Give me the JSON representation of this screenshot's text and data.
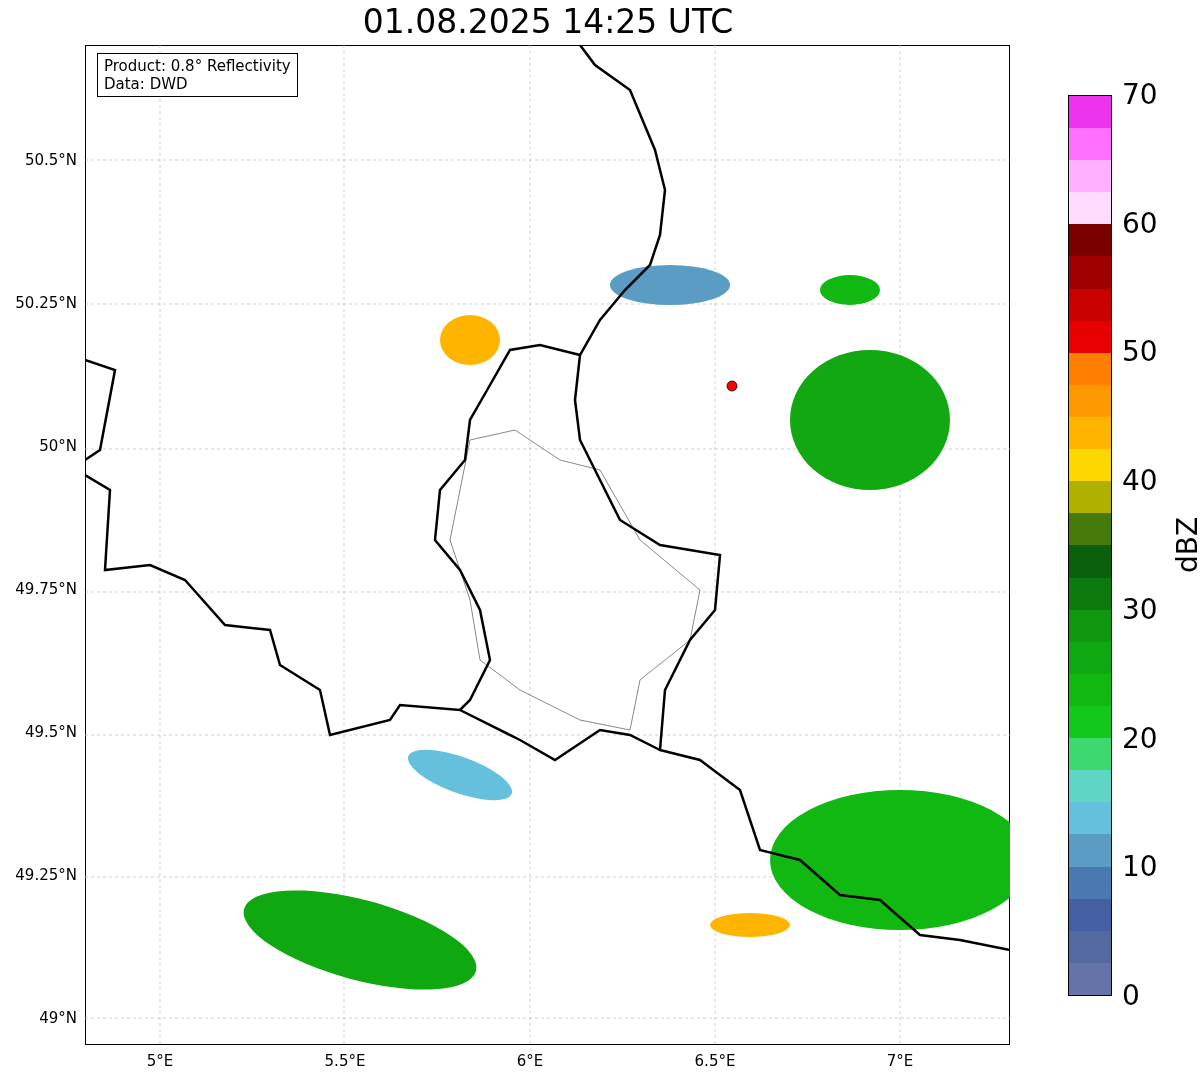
{
  "title": "01.08.2025 14:25 UTC",
  "legend": [
    "Product: 0.8° Reflectivity",
    "Data: DWD"
  ],
  "y_axis": {
    "ticks": [
      "50.5°N",
      "50.25°N",
      "50°N",
      "49.75°N",
      "49.5°N",
      "49.25°N",
      "49°N"
    ]
  },
  "x_axis": {
    "ticks": [
      "5°E",
      "5.5°E",
      "6°E",
      "6.5°E",
      "7°E"
    ]
  },
  "colorbar": {
    "label": "dBZ",
    "ticks": [
      "70",
      "60",
      "50",
      "40",
      "30",
      "20",
      "10",
      "0"
    ],
    "segments": [
      {
        "color": "#6673a8"
      },
      {
        "color": "#5469a0"
      },
      {
        "color": "#4460a3"
      },
      {
        "color": "#4a78b0"
      },
      {
        "color": "#5a9cc4"
      },
      {
        "color": "#64c0dc"
      },
      {
        "color": "#5fd5c5"
      },
      {
        "color": "#3dd870"
      },
      {
        "color": "#12c81a"
      },
      {
        "color": "#12b812"
      },
      {
        "color": "#10a810"
      },
      {
        "color": "#0f980f"
      },
      {
        "color": "#0d7a0d"
      },
      {
        "color": "#0a5f0a"
      },
      {
        "color": "#467a0a"
      },
      {
        "color": "#b0b000"
      },
      {
        "color": "#ffd700"
      },
      {
        "color": "#ffb400"
      },
      {
        "color": "#ff9900"
      },
      {
        "color": "#ff7d00"
      },
      {
        "color": "#e60000"
      },
      {
        "color": "#c80000"
      },
      {
        "color": "#a00000"
      },
      {
        "color": "#7a0000"
      },
      {
        "color": "#ffdcff"
      },
      {
        "color": "#ffb0ff"
      },
      {
        "color": "#ff70ff"
      },
      {
        "color": "#ee33ee"
      }
    ]
  }
}
